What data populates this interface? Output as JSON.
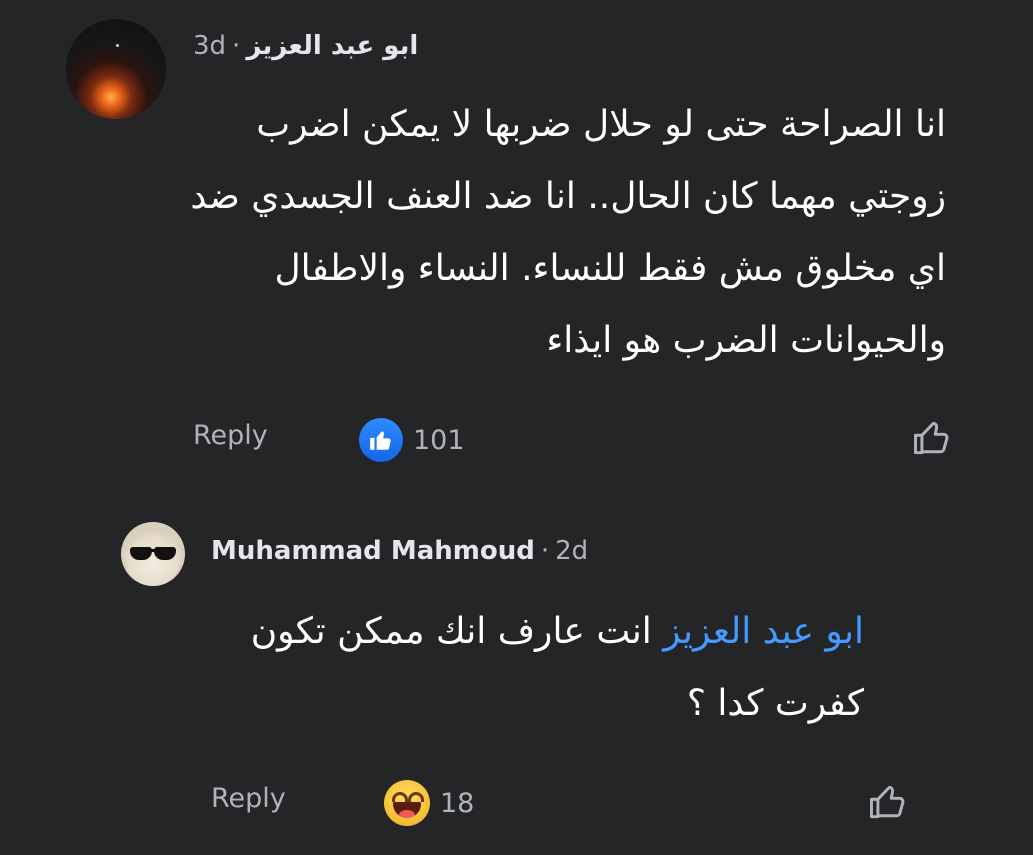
{
  "comments": [
    {
      "author": "ابو عبد العزيز",
      "separator": "·",
      "time": "3d",
      "text": "انا الصراحة حتى لو حلال ضربها لا يمكن اضرب زوجتي مهما كان الحال.. انا ضد العنف الجسدي ضد اي مخلوق مش فقط للنساء. النساء والاطفال والحيوانات الضرب هو ايذاء",
      "reply_label": "Reply",
      "reaction": "like",
      "reaction_count": "101"
    },
    {
      "author": "Muhammad Mahmoud",
      "separator": "·",
      "time": "2d",
      "mention": "ابو عبد العزيز",
      "text": " انت عارف انك ممكن تكون كفرت كدا ؟",
      "reply_label": "Reply",
      "reaction": "haha",
      "reaction_count": "18"
    }
  ],
  "colors": {
    "background": "#242526",
    "text": "#ffffff",
    "secondary": "#b0b3b8",
    "mention": "#4599ff",
    "like_blue": "#1877f2"
  },
  "icons": [
    "like-reaction-icon",
    "haha-reaction-icon",
    "thumbs-up-outline-icon"
  ]
}
